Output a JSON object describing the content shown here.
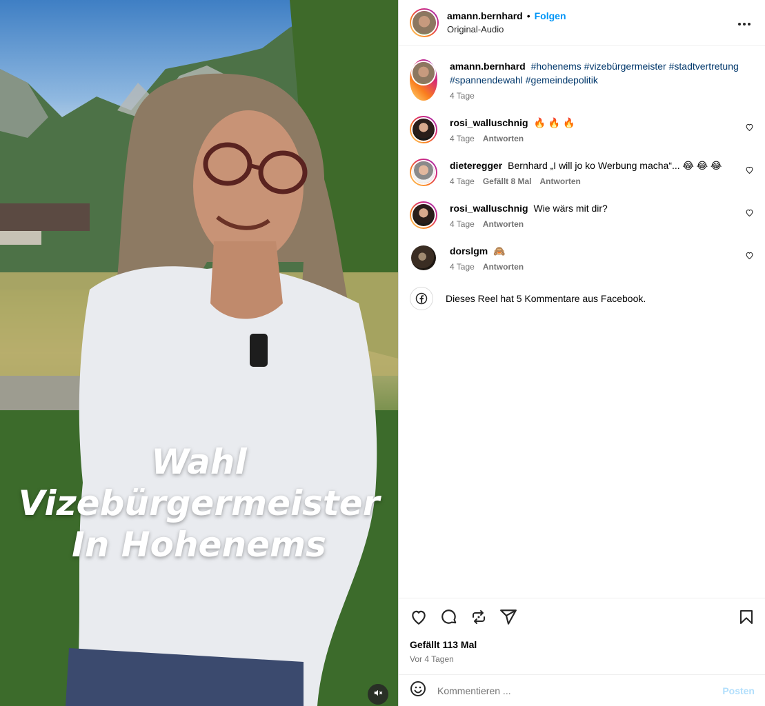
{
  "media": {
    "overlay_lines": [
      "Wahl",
      "Vizebürgermeister",
      "In Hohenems"
    ]
  },
  "header": {
    "username": "amann.bernhard",
    "separator": "•",
    "follow_label": "Folgen",
    "audio": "Original-Audio"
  },
  "caption": {
    "username": "amann.bernhard",
    "hashtags": [
      "#hohenems",
      "#vizebürgermeister",
      "#stadtvertretung",
      "#spannendewahl",
      "#gemeindepolitik"
    ],
    "time": "4 Tage"
  },
  "comments": [
    {
      "username": "rosi_walluschnig",
      "text": "🔥 🔥 🔥",
      "time": "4 Tage",
      "likes": "",
      "reply": "Antworten"
    },
    {
      "username": "dieteregger",
      "text": "Bernhard „I will jo ko Werbung macha“... 😂 😂 😂",
      "time": "4 Tage",
      "likes": "Gefällt 8 Mal",
      "reply": "Antworten"
    },
    {
      "username": "rosi_walluschnig",
      "text": "Wie wärs mit dir?",
      "time": "4 Tage",
      "likes": "",
      "reply": "Antworten"
    },
    {
      "username": "dorslgm",
      "text": "🙈",
      "time": "4 Tage",
      "likes": "",
      "reply": "Antworten"
    }
  ],
  "facebook_note": "Dieses Reel hat 5 Kommentare aus Facebook.",
  "stats": {
    "likes": "Gefällt 113 Mal",
    "posted": "Vor 4 Tagen"
  },
  "composer": {
    "placeholder": "Kommentieren ...",
    "post_label": "Posten"
  },
  "icons": {
    "more": "more-options-icon",
    "like": "heart-icon",
    "comment": "comment-icon",
    "repost": "repost-icon",
    "share": "share-icon",
    "save": "bookmark-icon",
    "emoji": "emoji-icon",
    "facebook": "facebook-icon",
    "mute": "muted-icon"
  },
  "colors": {
    "link": "#0095f6",
    "hashtag": "#00376b",
    "muted_text": "#737373",
    "post_disabled": "#b2dffc"
  }
}
